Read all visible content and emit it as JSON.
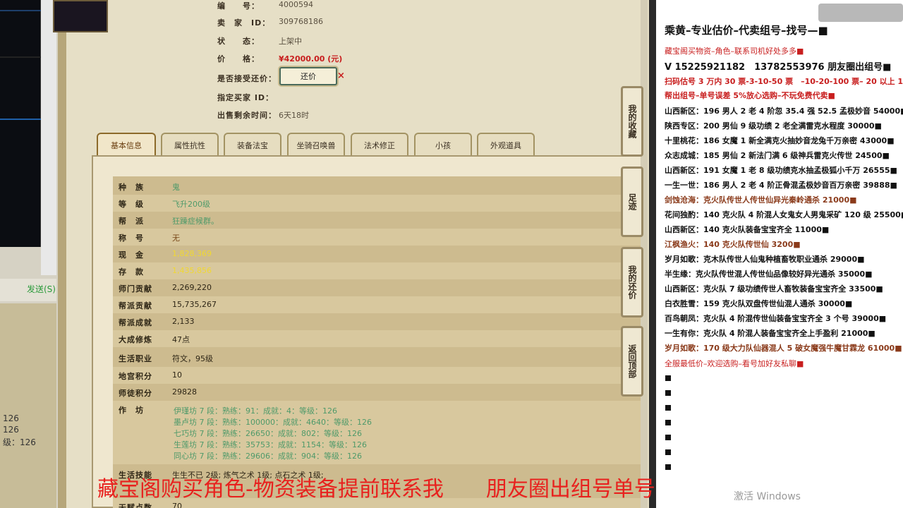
{
  "left": {
    "send_label": "发送(S)",
    "numbers": [
      "126",
      "126",
      "级：126"
    ]
  },
  "listing": {
    "rows": [
      {
        "label": "编　　号：",
        "value": "4000594"
      },
      {
        "label": "卖　家　ID：",
        "value": "309768186"
      },
      {
        "label": "状　　态：",
        "value": "上架中"
      },
      {
        "label": "价　　格：",
        "value": "¥42000.00 (元)"
      },
      {
        "label": "是否接受还价：",
        "value": ""
      },
      {
        "label": "指定买家 ID：",
        "value": ""
      },
      {
        "label": "出售剩余时间：",
        "value": "6天18时"
      }
    ],
    "counter_offer_label": "还价",
    "close_icon": "×"
  },
  "tabs": [
    "基本信息",
    "属性抗性",
    "装备法宝",
    "坐骑召唤兽",
    "法术修正",
    "小孩",
    "外观道具"
  ],
  "basic_info": [
    {
      "label": "种　族",
      "value": "鬼",
      "color": "green"
    },
    {
      "label": "等　级",
      "value": "飞升200级",
      "color": "green"
    },
    {
      "label": "帮　派",
      "value": "狂躁症候群。",
      "color": "green"
    },
    {
      "label": "称　号",
      "value": "无",
      "color": "brown"
    },
    {
      "label": "现　金",
      "value": "1,828,369",
      "color": "yellow"
    },
    {
      "label": "存　款",
      "value": "1,435,856",
      "color": "yellow"
    },
    {
      "label": "师门贡献",
      "value": "2,269,220",
      "color": "plain"
    },
    {
      "label": "帮派贡献",
      "value": "15,735,267",
      "color": "plain"
    },
    {
      "label": "帮派成就",
      "value": "2,133",
      "color": "plain"
    },
    {
      "label": "大成修炼",
      "value": "47点",
      "color": "plain"
    },
    {
      "label": "生活职业",
      "value": "符文，95级",
      "color": "plain"
    },
    {
      "label": "地宫积分",
      "value": "10",
      "color": "plain"
    },
    {
      "label": "师徒积分",
      "value": "29828",
      "color": "plain"
    }
  ],
  "workshop": {
    "label": "作　坊",
    "lines": [
      "伊瑾坊 7 段：熟练：91：成就：4：等级：126",
      "墨卢坊 7 段：熟练：100000：成就：4640：等级：126",
      "七巧坊 7 段：熟练：26650：成就：802：等级：126",
      "生莲坊 7 段：熟练：35753：成就：1154：等级：126",
      "同心坊 7 段：熟练：29606：成就：904：等级：126"
    ]
  },
  "life_skill": {
    "label": "生活技能",
    "value": "生生不已 2级; 炼气之术 1级; 点石之术 1级;"
  },
  "bottom_row": {
    "label": "天赋点数",
    "value": "70"
  },
  "side_buttons": [
    "我的收藏",
    "足迹",
    "我的还价",
    "返回顶部"
  ],
  "chat": {
    "title": "乘黄–专业估价–代卖组号–找号—■",
    "lines": [
      {
        "text": "藏宝阁买物资–角色–联系司机好处多多■",
        "style": "red"
      },
      {
        "text": "V 15225921182　13782553976 朋友圈出组号■",
        "style": "big"
      },
      {
        "text": "扫码估号 3 万内 30 票-3-10-50 票　–10-20-100 票– 20 以上 150■",
        "style": "red-bold"
      },
      {
        "text": "帮出组号–单号误差 5%放心选购–不玩免费代卖■",
        "style": "red-bold"
      },
      {
        "text": "山西新区：196 男人 2 老 4 阶忽 35.4 强 52.5 孟极妙音 54000■",
        "style": "bold"
      },
      {
        "text": "陕西专区：200 男仙 9 级功绩 2 老全满雷克水程度 30000■",
        "style": "bold"
      },
      {
        "text": "十里桃花：186 女魔 1 新全满克火抽妙音龙兔千万亲密 43000■",
        "style": "bold"
      },
      {
        "text": "众志成城：185 男仙 2 新法门满 6 级神兵雷克火传世 24500■",
        "style": "bold"
      },
      {
        "text": "山西新区：191 女魔 1 老 8 级功绩克水抽孟极狐小千万 26555■",
        "style": "bold"
      },
      {
        "text": "一生一世：186 男人 2 老 4 阶正骨混孟极妙音百万亲密 39888■",
        "style": "bold"
      },
      {
        "text": "剑蚀沧海：克火队传世人传世仙异光秦岭通杀 21000■",
        "style": "brown-bold"
      },
      {
        "text": "花间独酌：140 克火队 4 阶混人女鬼女人男鬼采矿 120 级 25500■",
        "style": "bold"
      },
      {
        "text": "山西新区：140 克火队装备宝宝齐全 11000■",
        "style": "bold"
      },
      {
        "text": "江枫渔火：140 克火队传世仙 3200■",
        "style": "brown-bold"
      },
      {
        "text": "岁月如歌：克木队传世人仙鬼种植畜牧职业通杀 29000■",
        "style": "bold"
      },
      {
        "text": "半生缘：克火队传世混人传世仙品像较好异光通杀 35000■",
        "style": "bold"
      },
      {
        "text": "山西新区：克火队 7 级功绩传世人畜牧装备宝宝齐全 33500■",
        "style": "bold"
      },
      {
        "text": "白衣胜雪：159 克火队双盘传世仙混人通杀 30000■",
        "style": "bold"
      },
      {
        "text": "百鸟朝凤：克火队 4 阶混传世仙装备宝宝齐全 3 个号 39000■",
        "style": "bold"
      },
      {
        "text": "一生有你：克火队 4 阶混人装备宝宝齐全上手盈利 21000■",
        "style": "bold"
      },
      {
        "text": "岁月如歌：170 级大力队仙器混人 5 破女魔强牛魔甘霖龙 61000■",
        "style": "brown-bold"
      },
      {
        "text": "全服最低价–欢迎选购–看号加好友私聊■",
        "style": "red"
      }
    ]
  },
  "overlay": {
    "text": "藏宝阁购买角色-物资装备提前联系我　　朋友圈出组号单号"
  },
  "watermark": {
    "text": "激活 Windows"
  }
}
